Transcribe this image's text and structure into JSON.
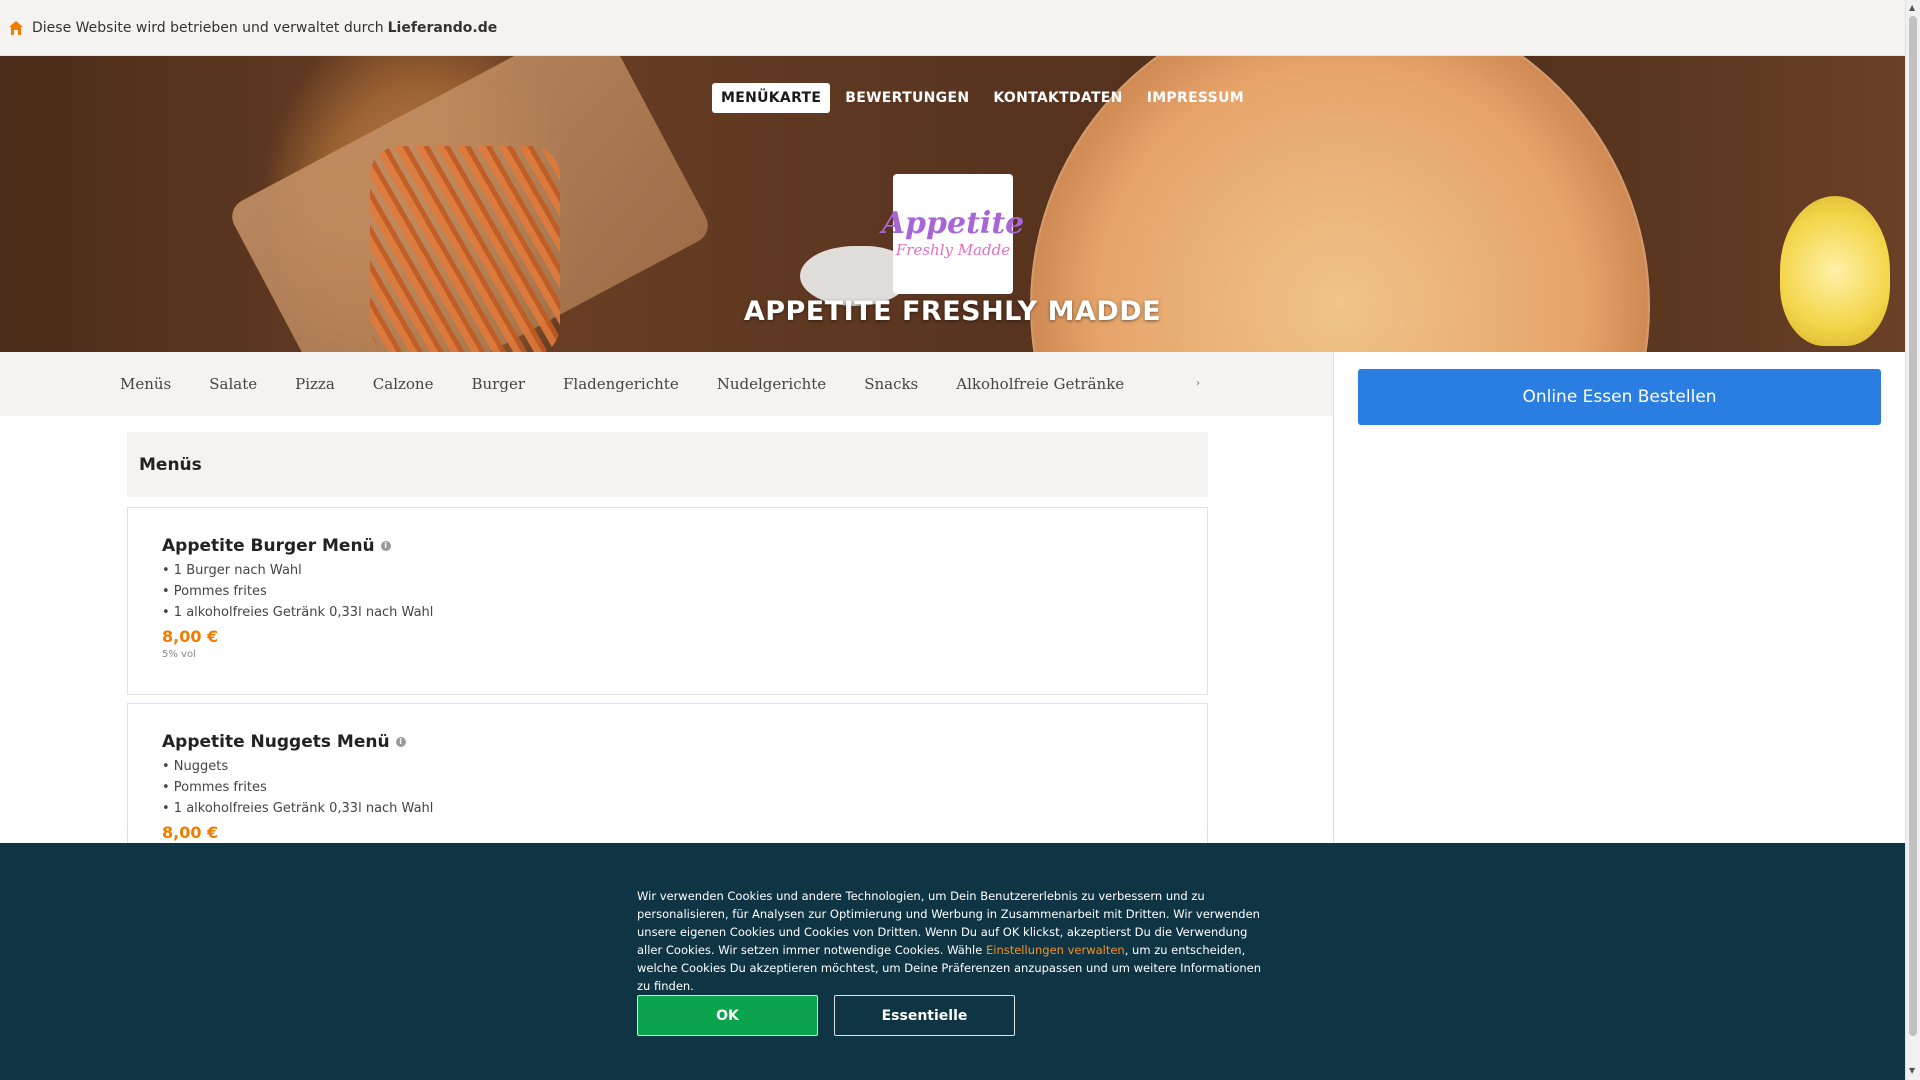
{
  "topbar": {
    "text": "Diese Website wird betrieben und verwaltet durch",
    "brand": "Lieferando.de"
  },
  "nav": {
    "items": [
      "MENÜKARTE",
      "BEWERTUNGEN",
      "KONTAKTDATEN",
      "IMPRESSUM"
    ],
    "active": "MENÜKARTE"
  },
  "logo": {
    "line1": "Appetite",
    "line2": "Freshly Madde"
  },
  "restaurant": {
    "name": "APPETITE FRESHLY MADDE"
  },
  "categories": [
    "Menüs",
    "Salate",
    "Pizza",
    "Calzone",
    "Burger",
    "Fladengerichte",
    "Nudelgerichte",
    "Snacks",
    "Alkoholfreie Getränke"
  ],
  "categories_more": "›",
  "order_button": "Online Essen Bestellen",
  "section": {
    "title": "Menüs"
  },
  "items": [
    {
      "name": "Appetite Burger Menü",
      "desc": [
        "• 1 Burger nach Wahl",
        "• Pommes frites",
        "• 1 alkoholfreies Getränk 0,33l nach Wahl"
      ],
      "price": "8,00 €",
      "note": "5% vol"
    },
    {
      "name": "Appetite Nuggets Menü",
      "desc": [
        "• Nuggets",
        "• Pommes frites",
        "• 1 alkoholfreies Getränk 0,33l nach Wahl"
      ],
      "price": "8,00 €",
      "note": ""
    }
  ],
  "cookie": {
    "text_before": "Wir verwenden Cookies und andere Technologien, um Dein Benutzererlebnis zu verbessern und zu personalisieren, für Analysen zur Optimierung und Werbung in Zusammenarbeit mit Dritten. Wir verwenden unsere eigenen Cookies und Cookies von Dritten. Wenn Du auf OK klickst, akzeptierst Du die Verwendung aller Cookies. Wir setzen immer notwendige Cookies. Wähle ",
    "link": "Einstellungen verwalten",
    "text_after": ", um zu entscheiden, welche Cookies Du akzeptieren möchtest, um Deine Präferenzen anzupassen und um weitere Informationen zu finden.",
    "ok": "OK",
    "essential": "Essentielle"
  },
  "colors": {
    "order_blue": "#2a7de1",
    "price_orange": "#f07c00",
    "cookie_bg": "#0f3443",
    "ok_green": "#0aa24a"
  },
  "icons": {
    "home": "home-icon",
    "info": "info-icon"
  }
}
